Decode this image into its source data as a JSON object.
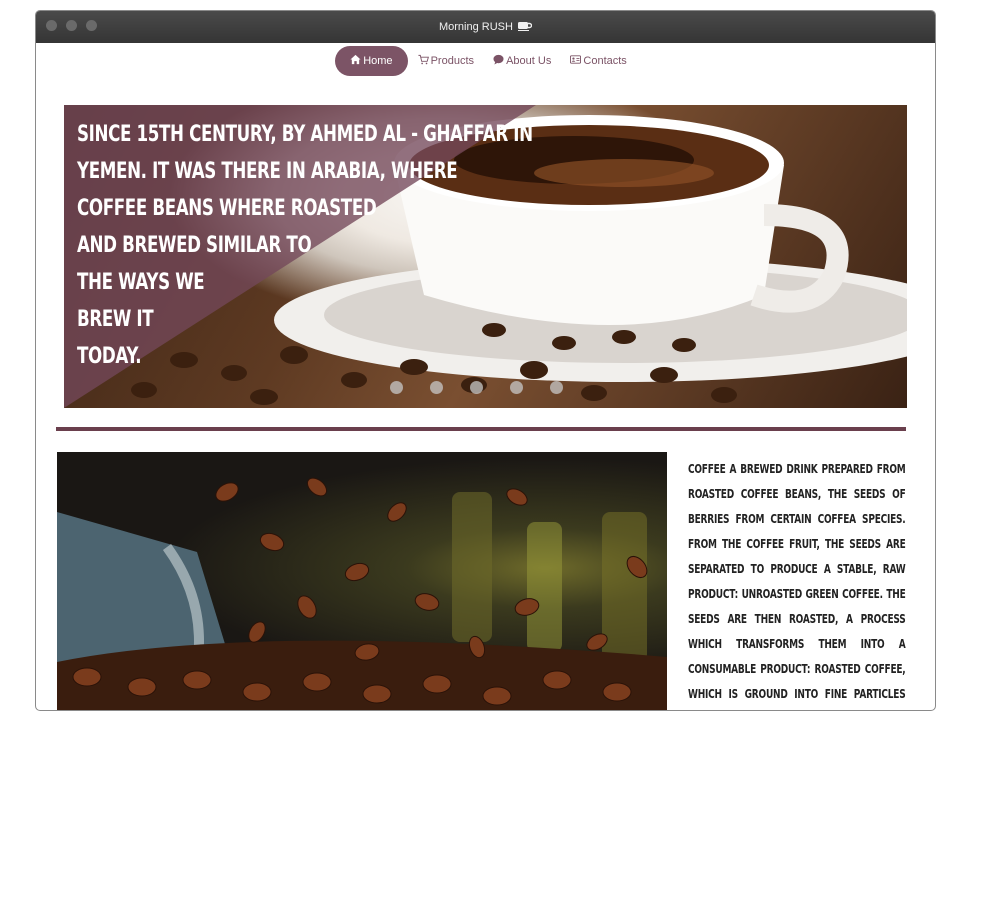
{
  "window": {
    "title": "Morning RUSH",
    "title_icon": "coffee-cup-icon"
  },
  "nav": {
    "items": [
      {
        "label": "Home",
        "icon": "home-icon",
        "active": true
      },
      {
        "label": "Products",
        "icon": "cart-icon",
        "active": false
      },
      {
        "label": "About Us",
        "icon": "chat-bubble-icon",
        "active": false
      },
      {
        "label": "Contacts",
        "icon": "address-card-icon",
        "active": false
      }
    ]
  },
  "hero": {
    "lines": [
      "Since 15th century, by Ahmed al - Ghaffar in",
      "Yemen. It was there in Arabia, where",
      "coffee beans where roasted",
      "and brewed similar to",
      "the ways we",
      "brew it",
      "today."
    ],
    "slide_count": 5,
    "active_slide": 1
  },
  "article": {
    "text": "Coffee a brewed drink prepared from roasted coffee beans, the seeds of berries from certain Coffea species. From the coffee fruit, the seeds are separated to produce a stable, raw product: unroasted green coffee. The seeds are then roasted, a process which transforms them into a consumable product: roasted coffee, which is ground into fine particles that are typically steeped in hot water before"
  },
  "colors": {
    "accent": "#7c5466",
    "titlebar": "#3d3d3d",
    "divider": "#6a3f4d"
  }
}
